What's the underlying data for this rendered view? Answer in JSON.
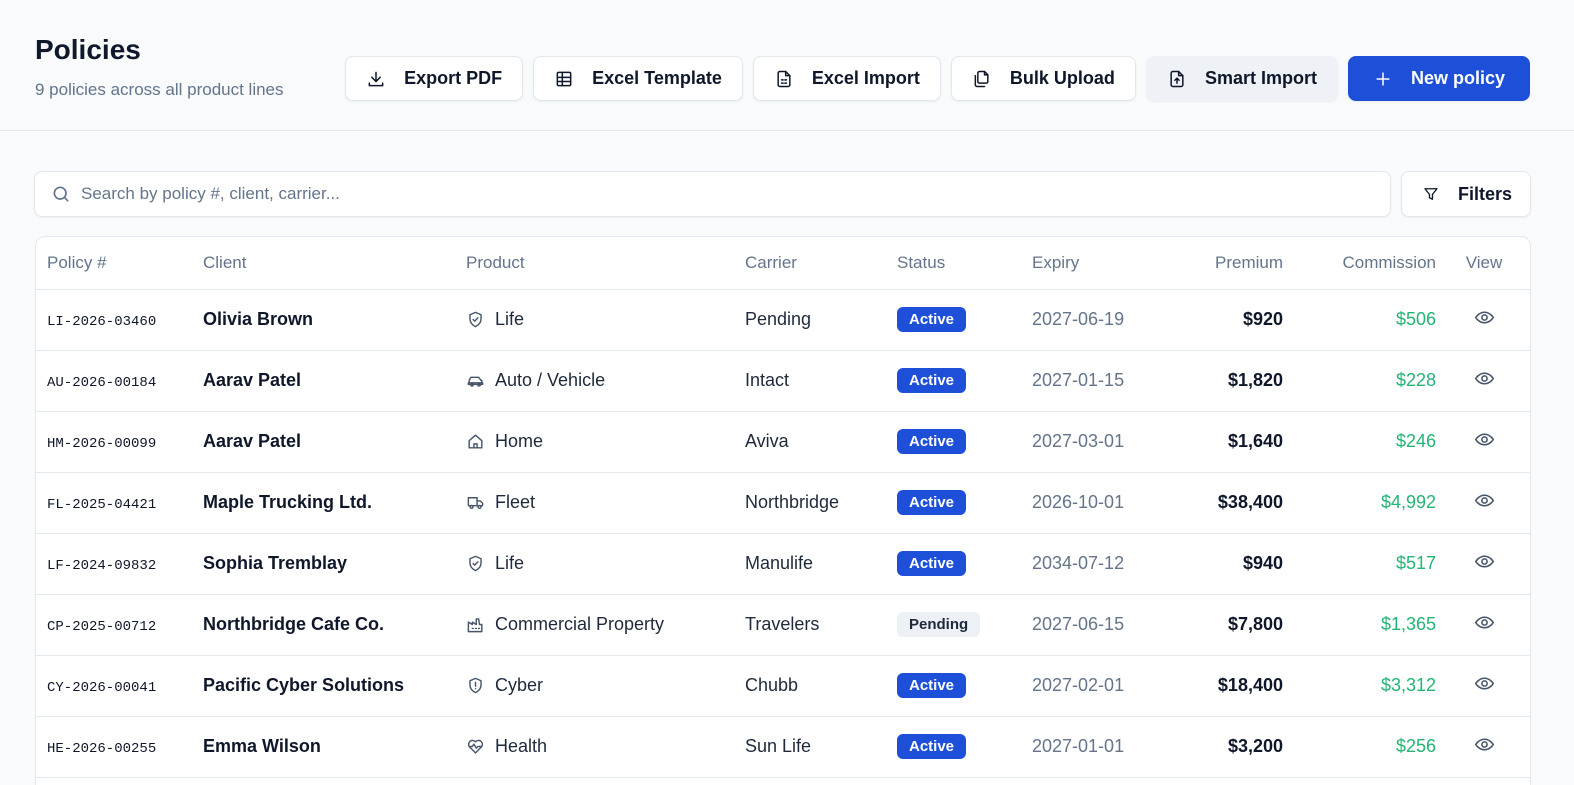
{
  "header": {
    "title": "Policies",
    "subtitle": "9 policies across all product lines"
  },
  "actions": {
    "export_pdf": "Export PDF",
    "excel_template": "Excel Template",
    "excel_import": "Excel Import",
    "bulk_upload": "Bulk Upload",
    "smart_import": "Smart Import",
    "new_policy": "New policy"
  },
  "search": {
    "placeholder": "Search by policy #, client, carrier...",
    "value": ""
  },
  "filters": {
    "label": "Filters"
  },
  "table": {
    "columns": [
      "Policy #",
      "Client",
      "Product",
      "Carrier",
      "Status",
      "Expiry",
      "Premium",
      "Commission",
      "View"
    ],
    "rows": [
      {
        "policy": "LI-2026-03460",
        "client": "Olivia Brown",
        "product": "Life",
        "product_icon": "shield-icon",
        "carrier": "Pending",
        "status": "Active",
        "expiry": "2027-06-19",
        "premium": "$920",
        "commission": "$506"
      },
      {
        "policy": "AU-2026-00184",
        "client": "Aarav Patel",
        "product": "Auto / Vehicle",
        "product_icon": "car-icon",
        "carrier": "Intact",
        "status": "Active",
        "expiry": "2027-01-15",
        "premium": "$1,820",
        "commission": "$228"
      },
      {
        "policy": "HM-2026-00099",
        "client": "Aarav Patel",
        "product": "Home",
        "product_icon": "home-icon",
        "carrier": "Aviva",
        "status": "Active",
        "expiry": "2027-03-01",
        "premium": "$1,640",
        "commission": "$246"
      },
      {
        "policy": "FL-2025-04421",
        "client": "Maple Trucking Ltd.",
        "product": "Fleet",
        "product_icon": "truck-icon",
        "carrier": "Northbridge",
        "status": "Active",
        "expiry": "2026-10-01",
        "premium": "$38,400",
        "commission": "$4,992"
      },
      {
        "policy": "LF-2024-09832",
        "client": "Sophia Tremblay",
        "product": "Life",
        "product_icon": "shield-icon",
        "carrier": "Manulife",
        "status": "Active",
        "expiry": "2034-07-12",
        "premium": "$940",
        "commission": "$517"
      },
      {
        "policy": "CP-2025-00712",
        "client": "Northbridge Cafe Co.",
        "product": "Commercial Property",
        "product_icon": "factory-icon",
        "carrier": "Travelers",
        "status": "Pending",
        "expiry": "2027-06-15",
        "premium": "$7,800",
        "commission": "$1,365"
      },
      {
        "policy": "CY-2026-00041",
        "client": "Pacific Cyber Solutions",
        "product": "Cyber",
        "product_icon": "shield-alert-icon",
        "carrier": "Chubb",
        "status": "Active",
        "expiry": "2027-02-01",
        "premium": "$18,400",
        "commission": "$3,312"
      },
      {
        "policy": "HE-2026-00255",
        "client": "Emma Wilson",
        "product": "Health",
        "product_icon": "heart-pulse-icon",
        "carrier": "Sun Life",
        "status": "Active",
        "expiry": "2027-01-01",
        "premium": "$3,200",
        "commission": "$256"
      }
    ]
  },
  "colors": {
    "primary": "#1d4fd8",
    "commission": "#22b573",
    "muted_text": "#64748b"
  }
}
